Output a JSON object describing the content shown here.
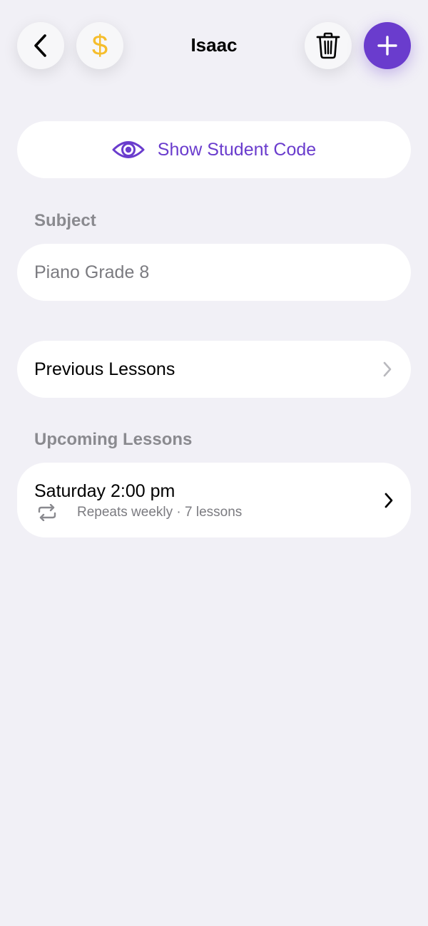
{
  "header": {
    "title": "Isaac",
    "back_icon": "chevron-left-icon",
    "dollar_icon": "dollar-sign-icon",
    "dollar_glyph": "$",
    "trash_icon": "trash-icon",
    "add_icon": "plus-icon"
  },
  "student_code": {
    "label": "Show Student Code",
    "icon": "eye-icon"
  },
  "subject": {
    "section_label": "Subject",
    "value": "Piano Grade 8"
  },
  "previous_lessons": {
    "label": "Previous Lessons",
    "icon": "chevron-right-icon"
  },
  "upcoming_lessons": {
    "section_label": "Upcoming Lessons",
    "items": [
      {
        "time": "Saturday 2:00 pm",
        "repeat": "Repeats weekly · 7 lessons",
        "icon": "repeat-icon"
      }
    ]
  },
  "colors": {
    "accent": "#6a3ccd",
    "dollar": "#f5bd2c",
    "background": "#f1f0f6",
    "card": "#ffffff",
    "secondary_text": "#8a8a8f"
  }
}
